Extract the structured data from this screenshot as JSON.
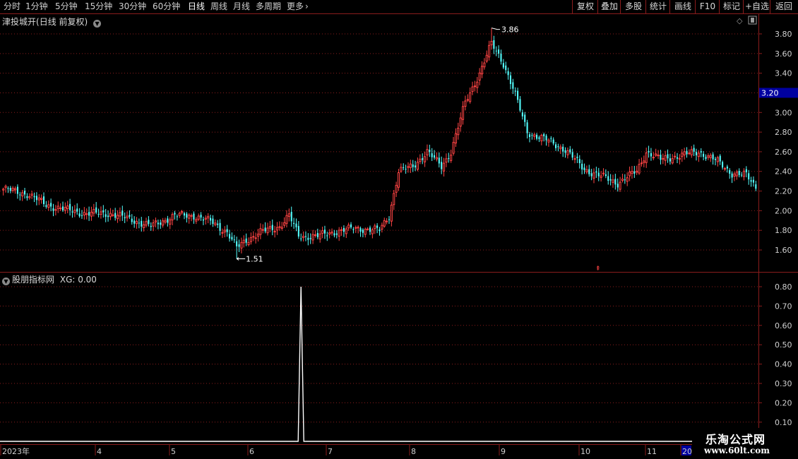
{
  "toolbar": {
    "periods": [
      "分时",
      "1分钟",
      "5分钟",
      "15分钟",
      "30分钟",
      "60分钟",
      "日线",
      "周线",
      "月线",
      "多周期",
      "更多"
    ],
    "active_period": "日线",
    "buttons": [
      "复权",
      "叠加",
      "多股",
      "统计",
      "画线",
      "F10",
      "标记",
      "+自选",
      "返回"
    ]
  },
  "main_chart": {
    "stock_name": "津投城开",
    "mode": "(日线 前复权)",
    "price_ticks": [
      "3.80",
      "3.60",
      "3.40",
      "3.20",
      "3.00",
      "2.80",
      "2.60",
      "2.40",
      "2.20",
      "2.00",
      "1.80",
      "1.60"
    ],
    "current_price_label": "3.20",
    "high_label": "3.86",
    "low_label": "1.51",
    "colors": {
      "up": "#ff4444",
      "down": "#54ffff",
      "grid": "#8a1c1c",
      "current_price_bg": "#0000a0"
    }
  },
  "indicator": {
    "name": "股朋指标网",
    "value_label": "XG: 0.00",
    "ticks": [
      "0.80",
      "0.70",
      "0.60",
      "0.50",
      "0.40",
      "0.30",
      "0.20",
      "0.10"
    ]
  },
  "time_axis": {
    "labels": [
      "2023年",
      "4",
      "5",
      "6",
      "7",
      "8",
      "9",
      "10",
      "11",
      "20"
    ]
  },
  "watermark": {
    "name": "乐淘公式网",
    "url": "www.60lt.com"
  },
  "chart_data": [
    {
      "type": "candlestick",
      "title": "津投城开(日线 前复权)",
      "ylim": [
        1.45,
        3.9
      ],
      "high": 3.86,
      "low": 1.51,
      "anchors": [
        [
          0,
          2.22
        ],
        [
          10,
          2.17
        ],
        [
          18,
          2.06
        ],
        [
          26,
          2.01
        ],
        [
          35,
          1.97
        ],
        [
          45,
          1.97
        ],
        [
          55,
          1.9
        ],
        [
          62,
          1.84
        ],
        [
          72,
          1.95
        ],
        [
          80,
          1.95
        ],
        [
          88,
          1.88
        ],
        [
          94,
          1.78
        ],
        [
          98,
          1.62
        ],
        [
          102,
          1.7
        ],
        [
          108,
          1.78
        ],
        [
          116,
          1.84
        ],
        [
          120,
          1.95
        ],
        [
          124,
          1.74
        ],
        [
          132,
          1.74
        ],
        [
          140,
          1.79
        ],
        [
          148,
          1.82
        ],
        [
          158,
          1.8
        ],
        [
          162,
          1.95
        ],
        [
          166,
          2.4
        ],
        [
          172,
          2.45
        ],
        [
          178,
          2.6
        ],
        [
          184,
          2.45
        ],
        [
          188,
          2.6
        ],
        [
          194,
          3.1
        ],
        [
          200,
          3.4
        ],
        [
          205,
          3.7
        ],
        [
          210,
          3.5
        ],
        [
          214,
          3.25
        ],
        [
          220,
          2.8
        ],
        [
          228,
          2.72
        ],
        [
          236,
          2.62
        ],
        [
          244,
          2.42
        ],
        [
          252,
          2.34
        ],
        [
          258,
          2.28
        ],
        [
          266,
          2.4
        ],
        [
          270,
          2.6
        ],
        [
          276,
          2.52
        ],
        [
          284,
          2.56
        ],
        [
          292,
          2.6
        ],
        [
          300,
          2.5
        ],
        [
          306,
          2.38
        ],
        [
          312,
          2.36
        ],
        [
          316,
          2.24
        ]
      ]
    },
    {
      "type": "line",
      "title": "股朋指标网 XG: 0.00",
      "ylim": [
        0,
        0.85
      ],
      "signal_bar": 125,
      "signal_value": 0.8
    }
  ]
}
